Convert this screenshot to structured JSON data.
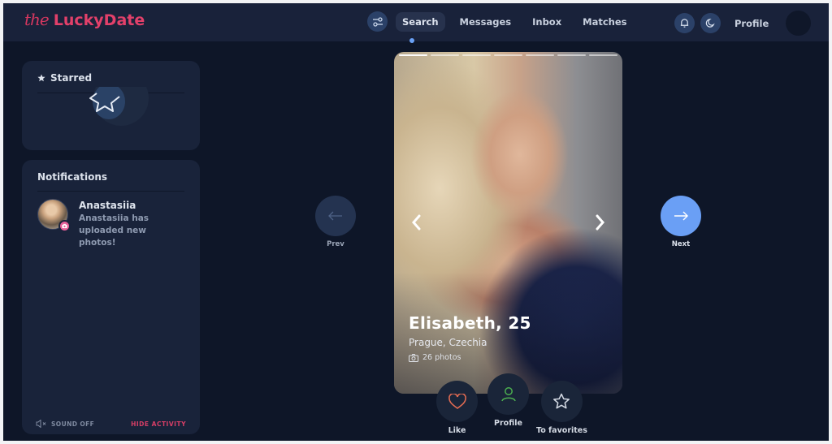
{
  "brand": {
    "prefix": "the",
    "name": "LuckyDate",
    "color": "#e2406a"
  },
  "header": {
    "filters_icon": "sliders-icon",
    "nav": [
      {
        "label": "Search",
        "active": true
      },
      {
        "label": "Messages",
        "active": false
      },
      {
        "label": "Inbox",
        "active": false
      },
      {
        "label": "Matches",
        "active": false
      }
    ],
    "notifications_icon": "bell-icon",
    "theme_icon": "moon-icon",
    "profile_label": "Profile"
  },
  "starred": {
    "title": "Starred",
    "icon": "star-icon"
  },
  "notifications": {
    "title": "Notifications",
    "items": [
      {
        "name": "Anastasiia",
        "text": "Anastasiia has uploaded new photos!",
        "badge_icon": "camera-icon"
      }
    ],
    "sound_label": "SOUND OFF",
    "hide_label": "HIDE ACTIVITY"
  },
  "profile_card": {
    "name_age": "Elisabeth, 25",
    "location": "Prague, Czechia",
    "photos_label": "26 photos",
    "photo_segments": 7,
    "current_segment": 1
  },
  "navigation": {
    "prev_label": "Prev",
    "next_label": "Next",
    "next_color": "#6a9ff5"
  },
  "actions": [
    {
      "label": "Like",
      "icon": "heart-icon",
      "color": "#e26b52"
    },
    {
      "label": "Profile",
      "icon": "user-icon",
      "color": "#4caf50"
    },
    {
      "label": "To favorites",
      "icon": "star-outline-icon",
      "color": "#d4dae4"
    }
  ]
}
